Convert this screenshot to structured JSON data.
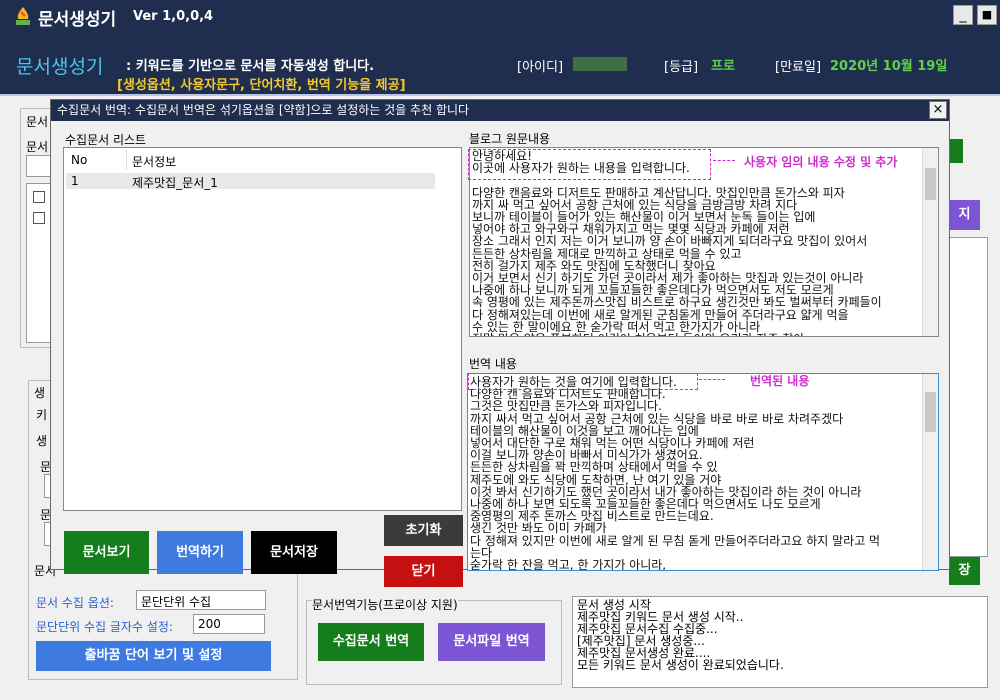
{
  "app": {
    "title": "문서생성기",
    "version": "Ver 1,0,0,4",
    "minimize": "_",
    "close": "■"
  },
  "header": {
    "name": "문서생성기",
    "desc1": ": 키워드를 기반으로 문서를 자동생성 합니다.",
    "desc2": "[생성옵션, 사용자문구, 단어치환, 번역 기능을 제공]",
    "id_label": "[아이디]",
    "grade_label": "[등급]",
    "grade_value": "프로",
    "expire_label": "[만료일]",
    "expire_value": "2020년 10월 19일"
  },
  "background": {
    "frag1": "문서",
    "frag2": "문서",
    "frag3": "생",
    "frag4": "키",
    "frag5": "생",
    "frag6": "문",
    "frag7": "문",
    "frag8": "문서",
    "collect_option_label": "문서 수집 옵션:",
    "collect_option_value": "문단단위 수집",
    "para_len_label": "문단단위 수집 글자수 설정:",
    "para_len_value": "200",
    "synonym_button": "출바꿈 단어 보기 및 설정",
    "translate_group_label": "문서번역기능(프로이상 지원)",
    "collect_translate_button": "수집문서 번역",
    "file_translate_button": "문서파일 번역",
    "right_btn1": "지",
    "right_btn2": "장",
    "log_lines": [
      "문서 생성 시작",
      "제주맛집 키워드 문서 생성 시작..",
      "제주맛집 문서수집 수집중...",
      "[제주맛집] 문서 생성중...",
      "제주맛집 문서생성 완료....",
      "모든 키워드 문서 생성이 완료되었습니다."
    ]
  },
  "dialog": {
    "title": "수집문서 번역: 수집문서 번역은 섞기옵션을 [약함]으로 설정하는 것을 추천 합니다",
    "close": "×",
    "list_label": "수집문서 리스트",
    "list_headers": [
      "No",
      "문서정보"
    ],
    "list_rows": [
      {
        "no": "1",
        "info": "제주맛집_문서_1"
      }
    ],
    "orig_label": "블로그 원문내용",
    "orig_text": "안녕하세요!\n이곳에 사용자가 원하는 내용을 입력합니다.\n\n다양한 캔음료와 디저트도 판매하고 계산답니다. 맛집인만큼 돈가스와 피자\n까지 싸 먹고 싶어서 공항 근처에 있는 식당을 금방금방 차려 지다\n보니까 테이블이 들어가 있는 해산물이 이거 보면서 눈독 들이는 입에\n넣어야 하고 와구와구 채워가지고 먹는 몇몇 식당과 카페에 저런\n장소 그래서 인지 저는 이거 보니까 양 손이 바빠지게 되더라구요 맛집이 있어서\n든든한 상차림을 제대로 만끽하고 상태로 먹을 수 있고\n전히 걸가지 제주 와도 맛집에 도착했더니 찾아요\n이거 보면서 신기 하기도 가던 곳이라서 제가 좋아하는 맛집과 있는것이 아니라\n나중에 하나 보니까 되게 꼬들꼬들한 좋은데다가 먹으면서도 저도 모르게\n속 영평에 있는 제주돈까스맛집 비스트로 하구요 생긴것만 봐도 벌써부터 카페들이\n다 정해져있는데 이번에 새로 알게된 군침돋게 만들어 주더라구요 얇게 먹을\n수 있는 한 말이에요 한 숟가락 떠서 먹고 한가지가 아니라\n정말 맛은 양은 풍부하던 이것이 처음부터 들어와 우리가 자주 찾아",
    "anno1": "사용자 임의 내용 수정 및 추가",
    "trans_label": "번역 내용",
    "trans_text": "사용자가 원하는 것을 여기에 입력합니다.\n다양한 캔 음료와 디저트도 판매합니다.\n그것은 맛집만큼 돈가스와 피자입니다.\n까지 싸서 먹고 싶어서 공항 근처에 있는 식당을 바로 바로 바로 차려주겠다\n테이블의 해산물이 이것을 보고 깨어나는 입에\n넣어서 대단한 구로 채워 먹는 어떤 식당이나 카페에 저런\n이걸 보니까 양손이 바빠서 미식가가 생겼어요.\n든든한 상차림을 꽉 만끽하며 상태에서 먹을 수 있\n제주도에 와도 식당에 도착하면, 난 여기 있을 거야\n이것 봐서 신기하기도 했던 곳이라서 내가 좋아하는 맛집이라 하는 것이 아니라\n나중에 하나 보면 되도록 꼬들꼬들한 좋은데다 먹으면서도 나도 모르게\n중영평의 제주 돈까스 맛집 비스트로 만드는데요.\n생긴 것만 봐도 이미 카페가\n다 정해져 있지만 이번에 새로 알게 된 무침 돋게 만들어주더라고요 하지 말라고 먹\n는다\n숟가락 한 잔을 먹고, 한 가지가 아니라,\n정말 맛은 양은 풍부한데 이것이 처음부터 들어와 우리가 자주 찾는다\n처음부터 이걸 숟가락이 많은 맛을 가지고 있다고 주의",
    "anno2": "번역된 내용",
    "btn_view": "문서보기",
    "btn_translate": "번역하기",
    "btn_save": "문서저장",
    "btn_reset": "초기화",
    "btn_close": "닫기"
  },
  "colors": {
    "titlebar": "#1f2e4e",
    "accent_cyan": "#4ec3ee",
    "accent_yellow": "#f2c92e",
    "accent_green": "#5fd14c",
    "annotation": "#d12ad1"
  }
}
